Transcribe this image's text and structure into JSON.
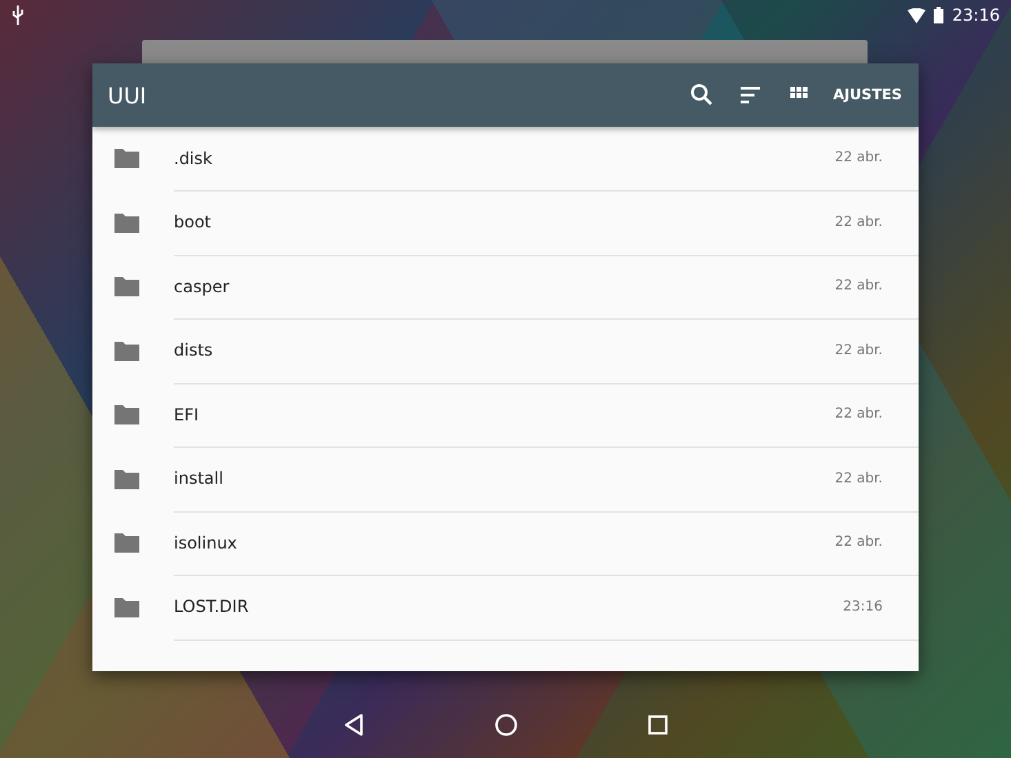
{
  "status_bar": {
    "time": "23:16"
  },
  "app_bar": {
    "title": "UUI",
    "action_label": "AJUSTES"
  },
  "files": [
    {
      "name": ".disk",
      "date": "22 abr."
    },
    {
      "name": "boot",
      "date": "22 abr."
    },
    {
      "name": "casper",
      "date": "22 abr."
    },
    {
      "name": "dists",
      "date": "22 abr."
    },
    {
      "name": "EFI",
      "date": "22 abr."
    },
    {
      "name": "install",
      "date": "22 abr."
    },
    {
      "name": "isolinux",
      "date": "22 abr."
    },
    {
      "name": "LOST.DIR",
      "date": "23:16"
    }
  ]
}
